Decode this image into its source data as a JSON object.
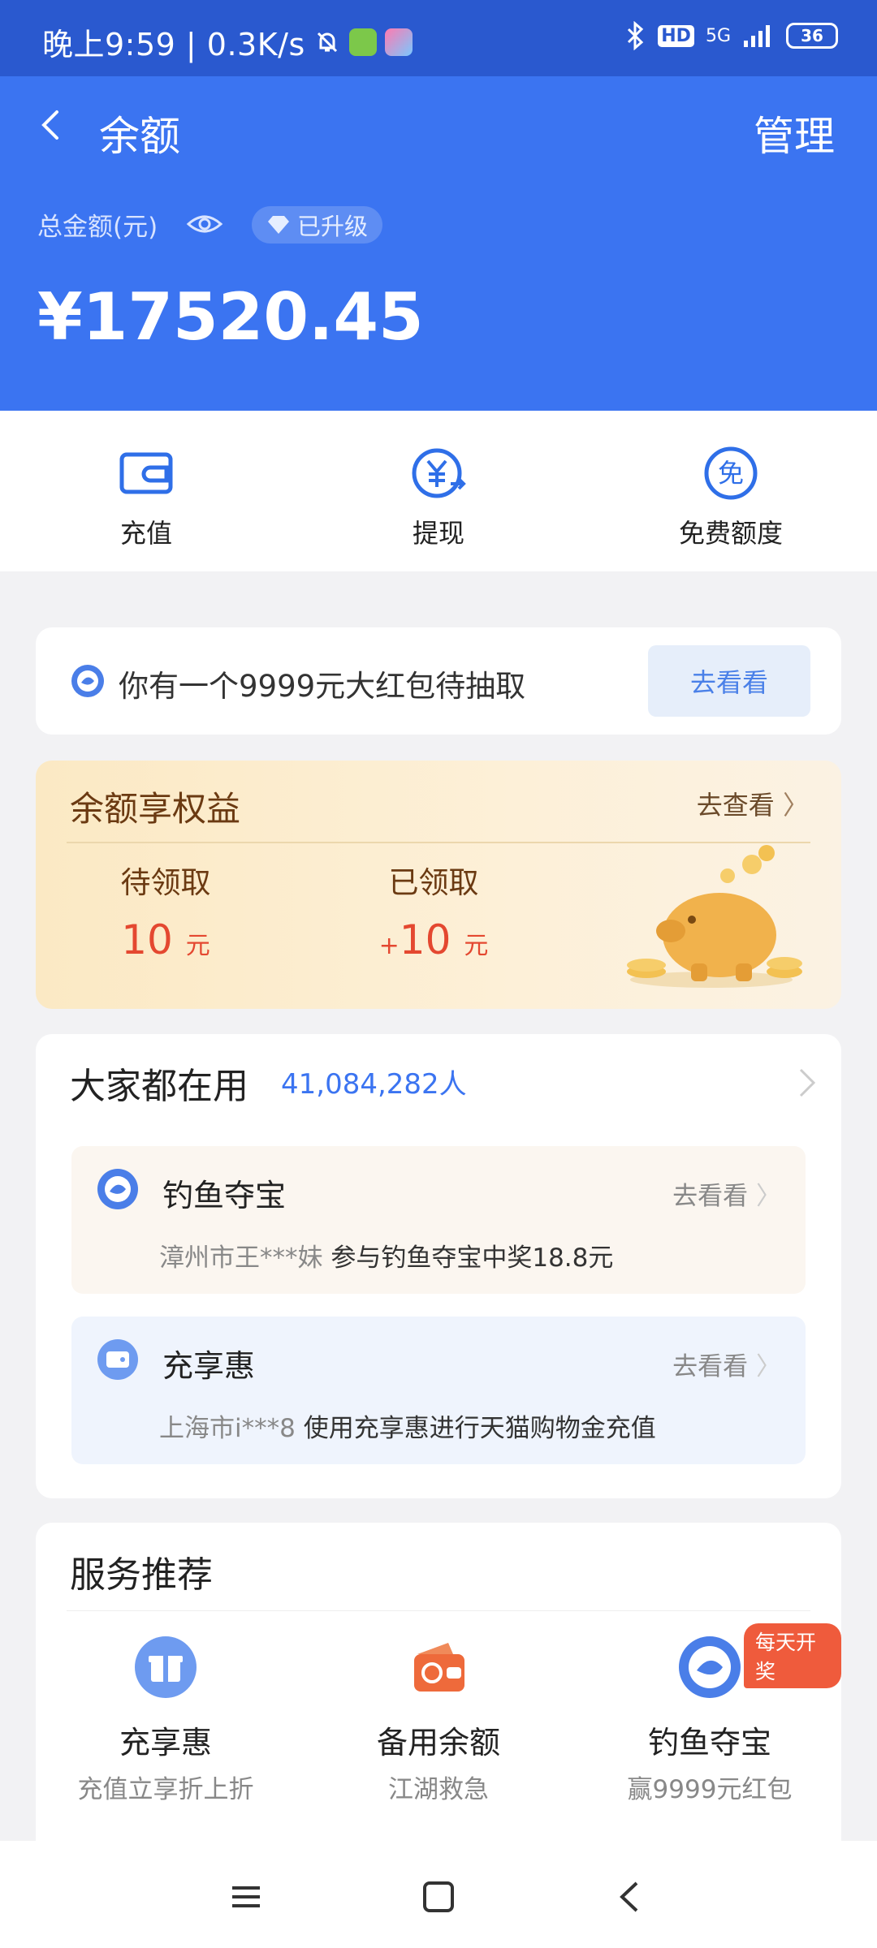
{
  "status_bar": {
    "time_text": "晚上9:59 | 0.3K/s",
    "network": "5G",
    "hd": "HD",
    "battery": "36"
  },
  "header": {
    "title": "余额",
    "manage_label": "管理",
    "total_label": "总金额(元)",
    "upgrade_label": "已升级",
    "amount": "¥17520.45"
  },
  "quick_actions": [
    {
      "label": "充值",
      "icon": "wallet-icon"
    },
    {
      "label": "提现",
      "icon": "withdraw-icon"
    },
    {
      "label": "免费额度",
      "icon": "free-quota-icon"
    }
  ],
  "promo": {
    "text": "你有一个9999元大红包待抽取",
    "button": "去看看"
  },
  "rights": {
    "title": "余额享权益",
    "link": "去查看",
    "pending_label": "待领取",
    "pending_value": "10",
    "pending_unit": "元",
    "received_label": "已领取",
    "received_value": "10",
    "received_prefix": "+",
    "received_unit": "元"
  },
  "popular": {
    "title": "大家都在用",
    "count": "41,084,282人",
    "items": [
      {
        "name": "钓鱼夺宝",
        "go": "去看看",
        "user": "漳州市王***妹",
        "desc": "参与钓鱼夺宝中奖18.8元",
        "bg": "#fbf6f0"
      },
      {
        "name": "充享惠",
        "go": "去看看",
        "user": "上海市i***8",
        "desc": "使用充享惠进行天猫购物金充值",
        "bg": "#eff4fd"
      }
    ]
  },
  "services": {
    "title": "服务推荐",
    "badge": "每天开奖",
    "items": [
      {
        "name": "充享惠",
        "desc": "充值立享折上折",
        "icon": "gift-icon"
      },
      {
        "name": "备用余额",
        "desc": "江湖救急",
        "icon": "backup-wallet-icon"
      },
      {
        "name": "钓鱼夺宝",
        "desc": "赢9999元红包",
        "icon": "fishing-icon"
      }
    ]
  },
  "colors": {
    "header_blue": "#3b74f1",
    "statusbar_blue": "#2a59cf",
    "accent_red": "#e44830",
    "link_blue": "#4a80e8"
  }
}
